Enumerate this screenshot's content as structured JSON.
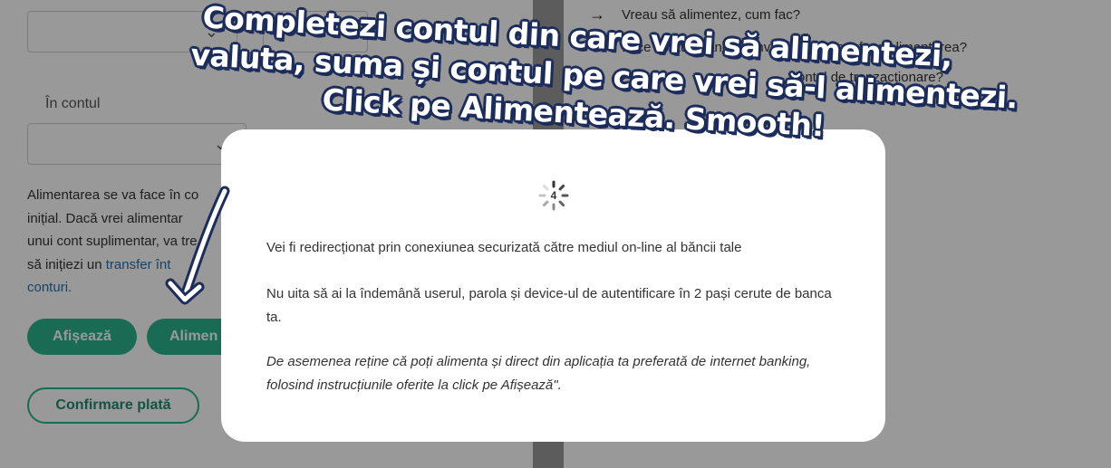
{
  "form": {
    "account_label": "În contul",
    "info_text_part1": "Alimentarea se va face în co",
    "info_text_line2": "inițial. Dacă vrei alimentar",
    "info_text_line3": "unui cont suplimentar, va tre",
    "info_text_line4_pre": "să inițiezi un ",
    "info_text_link1": "transfer înt",
    "info_text_link2": "conturi.",
    "btn_afiseaza": "Afișează",
    "btn_alimenteaza": "Alimen",
    "btn_confirmare": "Confirmare plată",
    "chevron": "⌄"
  },
  "faq": {
    "items": [
      "Vreau să alimentez, cum fac?",
      "În ce conturi bancare Investimental pot face alimentarea?",
      "ontul de tranzacționare?"
    ],
    "arrow": "→"
  },
  "modal": {
    "countdown": "4",
    "line1": "Vei fi redirecționat prin conexiunea securizată către mediul on-line al băncii tale",
    "line2": "Nu uita să ai la îndemână userul, parola și device-ul de autentificare în 2 pași cerute de banca ta.",
    "line3": "De asemenea reține că poți alimenta și direct din aplicația ta preferată de internet banking, folosind instrucțiunile oferite la click pe Afișează\"."
  },
  "caption": {
    "line1": "Completezi contul din care vrei să alimentezi,",
    "line2": "valuta, suma și contul pe care vrei să-l alimentezi.",
    "line3": "Click pe Alimentează. Smooth!"
  },
  "colors": {
    "accent": "#2bb38c",
    "caption_outline": "#1c2c5b",
    "link": "#2a6fb0"
  }
}
